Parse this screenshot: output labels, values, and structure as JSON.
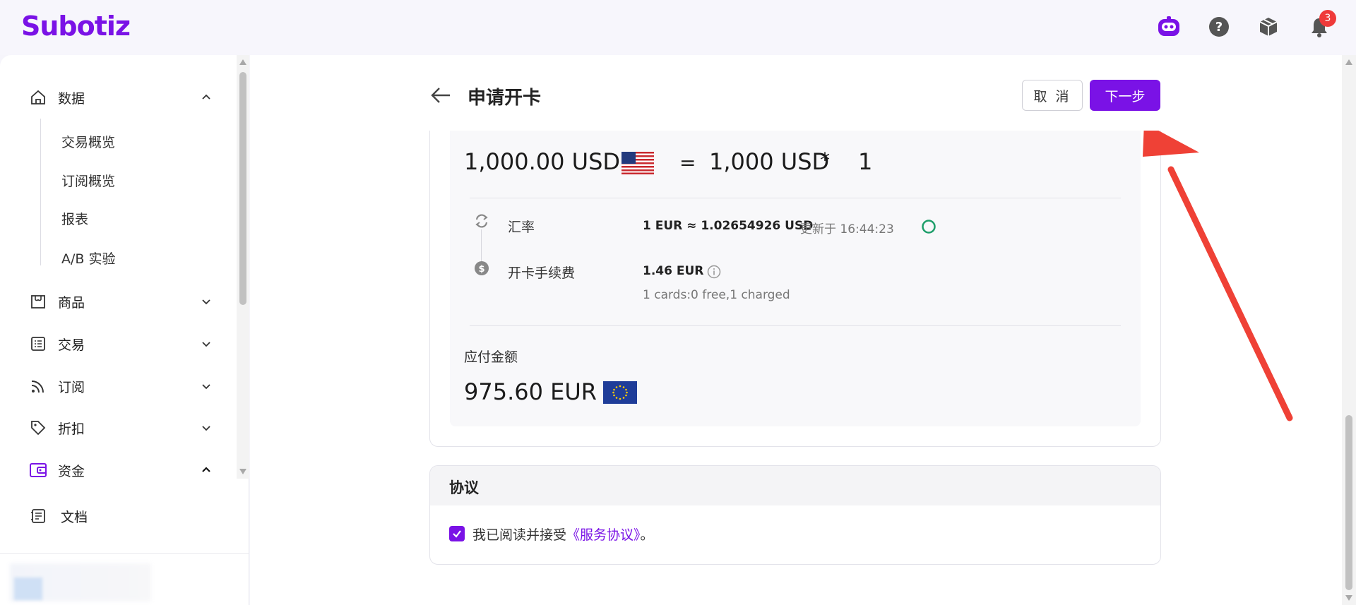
{
  "header": {
    "logo": "Subotiz",
    "notification_count": "3",
    "icons": [
      "ai-assistant-icon",
      "help-icon",
      "package-icon",
      "bell-icon"
    ]
  },
  "sidebar": {
    "items": [
      {
        "label": "数据",
        "icon": "home-icon",
        "expanded": true
      },
      {
        "label": "商品",
        "icon": "shop-icon",
        "expanded": false
      },
      {
        "label": "交易",
        "icon": "list-icon",
        "expanded": false
      },
      {
        "label": "订阅",
        "icon": "rss-icon",
        "expanded": false
      },
      {
        "label": "折扣",
        "icon": "tag-icon",
        "expanded": false
      },
      {
        "label": "资金",
        "icon": "wallet-icon",
        "expanded": true,
        "active": true
      },
      {
        "label": "文档",
        "icon": "doc-icon"
      }
    ],
    "data_subitems": [
      "交易概览",
      "订阅概览",
      "报表",
      "A/B 实验"
    ]
  },
  "page": {
    "title": "申请开卡",
    "cancel_label": "取 消",
    "next_label": "下一步"
  },
  "summary": {
    "amount": "1,000.00 USD",
    "equals": "=",
    "per_card": "1,000 USD",
    "times": "*",
    "count": "1",
    "rate_label": "汇率",
    "rate_value": "1 EUR ≈ 1.02654926 USD",
    "rate_updated": "更新于 16:44:23",
    "fee_label": "开卡手续费",
    "fee_value": "1.46 EUR",
    "fee_detail": "1 cards:0 free,1 charged",
    "payable_label": "应付金额",
    "payable_value": "975.60 EUR"
  },
  "agreement": {
    "title": "协议",
    "text": "我已阅读并接受",
    "link": "《服务协议》",
    "suffix": "。",
    "checked": true
  },
  "colors": {
    "brand": "#7a12e6",
    "annotation": "#ef4136"
  }
}
